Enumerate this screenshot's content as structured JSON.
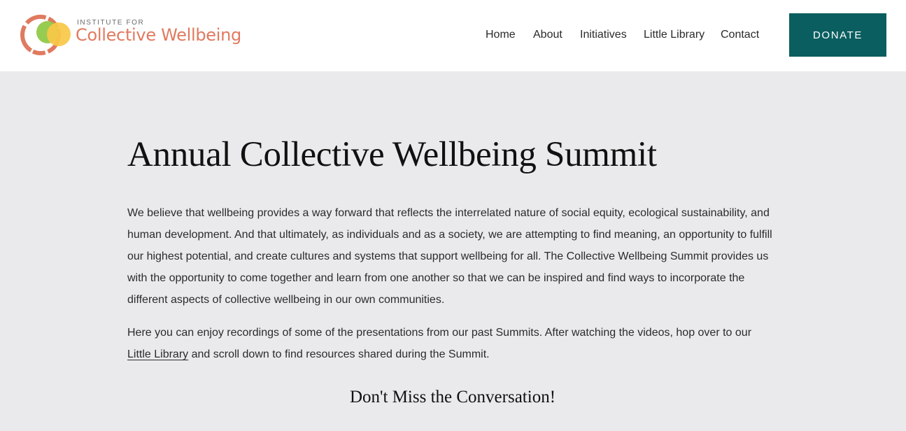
{
  "header": {
    "logo": {
      "small_text": "INSTITUTE FOR",
      "big_text": "Collective Wellbeing",
      "colors": {
        "orange": "#e07a5f",
        "green": "#8cc63f",
        "yellow": "#f9c846"
      }
    },
    "nav": [
      {
        "label": "Home"
      },
      {
        "label": "About"
      },
      {
        "label": "Initiatives"
      },
      {
        "label": "Little Library"
      },
      {
        "label": "Contact"
      }
    ],
    "donate_label": "DONATE",
    "donate_color": "#0b5e5f"
  },
  "main": {
    "title": "Annual Collective Wellbeing Summit",
    "paragraph1": "We believe that wellbeing provides a way forward that reflects the interrelated nature of social equity, ecological sustainability, and human development. And that ultimately, as individuals and as a society, we are attempting to find meaning, an opportunity to fulfill our highest potential, and create cultures and systems that support wellbeing for all. The Collective Wellbeing Summit provides us with the opportunity to come together and learn from one another so that we can be inspired and find ways to incorporate the different aspects of collective wellbeing in our own communities.",
    "paragraph2": {
      "before_link": "Here you can enjoy recordings of some of the presentations from our past Summits. After watching the videos, hop over to our ",
      "link_text": "Little Library",
      "after_link": " and scroll down to find resources shared during the Summit."
    },
    "subheading": "Don't Miss the Conversation!"
  }
}
